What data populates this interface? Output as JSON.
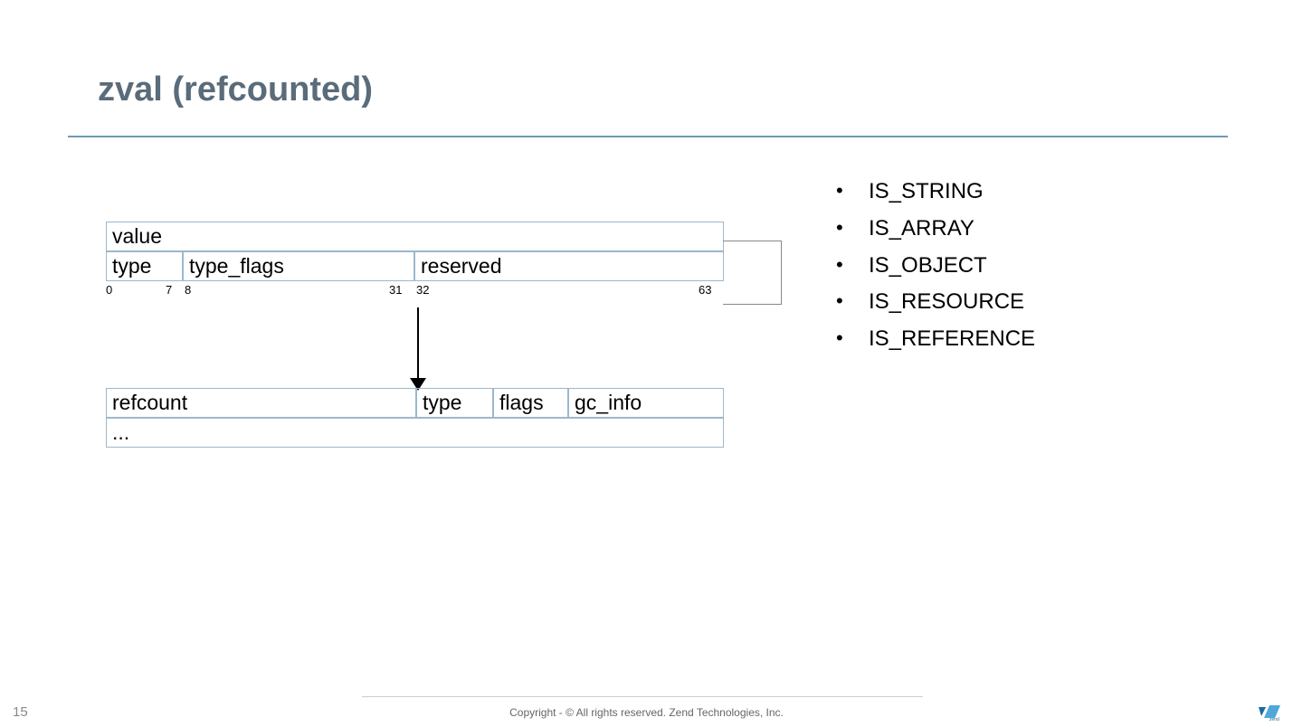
{
  "title": "zval (refcounted)",
  "diagram": {
    "value_label": "value",
    "type_label": "type",
    "type_flags_label": "type_flags",
    "reserved_label": "reserved",
    "bits": {
      "b0": "0",
      "b7": "7",
      "b8": "8",
      "b31": "31",
      "b32": "32",
      "b63": "63"
    },
    "refcount_label": "refcount",
    "rtype_label": "type",
    "flags_label": "flags",
    "gc_info_label": "gc_info",
    "ellipsis": "..."
  },
  "types": [
    "IS_STRING",
    "IS_ARRAY",
    "IS_OBJECT",
    "IS_RESOURCE",
    "IS_REFERENCE"
  ],
  "page_number": "15",
  "copyright": "Copyright - © All rights reserved. Zend Technologies, Inc."
}
